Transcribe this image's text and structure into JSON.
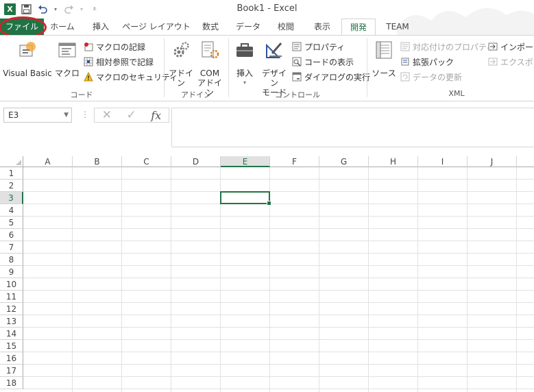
{
  "app": {
    "window_title": "Book1 - Excel",
    "logo_text": "X",
    "brand_color": "#217346",
    "highlight_color": "#d1252a"
  },
  "qat": {
    "icons": [
      "save-icon",
      "undo-icon",
      "redo-icon",
      "customize-icon"
    ]
  },
  "tabs": [
    {
      "label": "ファイル",
      "kind": "file"
    },
    {
      "label": "ホーム"
    },
    {
      "label": "挿入"
    },
    {
      "label": "ページ レイアウト"
    },
    {
      "label": "数式"
    },
    {
      "label": "データ"
    },
    {
      "label": "校閲"
    },
    {
      "label": "表示"
    },
    {
      "label": "開発",
      "active": true
    },
    {
      "label": "TEAM"
    }
  ],
  "ribbon": {
    "code": {
      "label": "コード",
      "visual_basic": "Visual Basic",
      "macro": "マクロ",
      "record_macro": "マクロの記録",
      "relative_ref": "相対参照で記録",
      "macro_security": "マクロのセキュリティ"
    },
    "addins": {
      "label": "アドイン",
      "addin": "アドイン",
      "com_line1": "COM",
      "com_line2": "アドイン"
    },
    "controls": {
      "label": "コントロール",
      "insert": "挿入",
      "design_line1": "デザイン",
      "design_line2": "モード",
      "properties": "プロパティ",
      "view_code": "コードの表示",
      "run_dialog": "ダイアログの実行"
    },
    "xml": {
      "label": "XML",
      "source": "ソース",
      "map_properties": "対応付けのプロパティ",
      "expansion_packs": "拡張パック",
      "refresh_data": "データの更新",
      "import": "インポート",
      "export": "エクスポート"
    }
  },
  "formula_bar": {
    "name_box": "E3",
    "fx_label": "fx",
    "formula": ""
  },
  "sheet": {
    "columns": [
      "A",
      "B",
      "C",
      "D",
      "E",
      "F",
      "G",
      "H",
      "I",
      "J"
    ],
    "rows": [
      "1",
      "2",
      "3",
      "4",
      "5",
      "6",
      "7",
      "8",
      "9",
      "10",
      "11",
      "12",
      "13",
      "14",
      "15",
      "16",
      "17",
      "18"
    ],
    "selected_column": "E",
    "selected_row": "3"
  }
}
